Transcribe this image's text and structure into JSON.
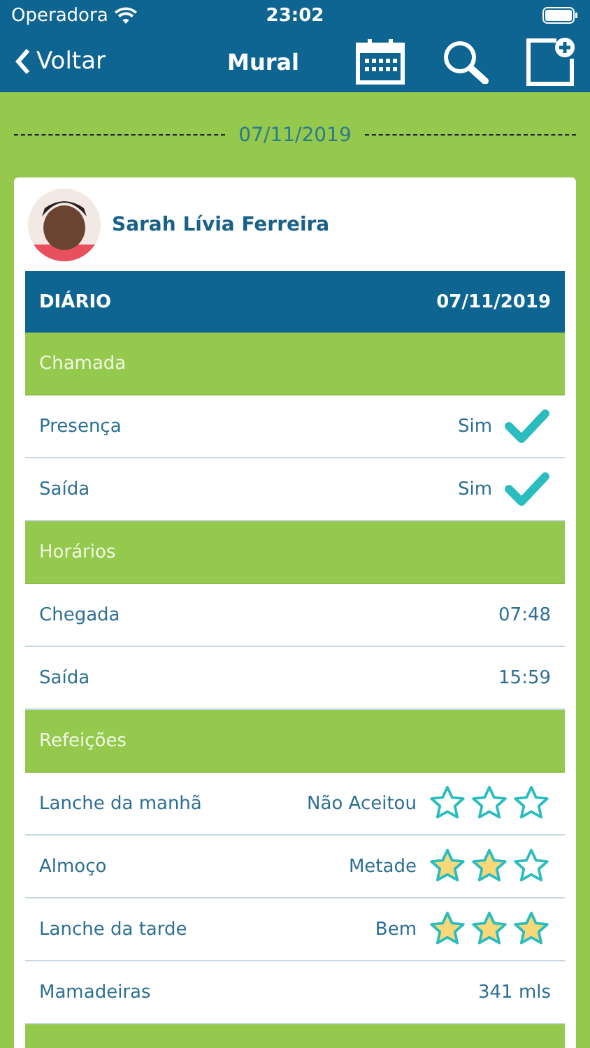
{
  "status_bar": {
    "carrier": "Operadora",
    "time": "23:02"
  },
  "nav": {
    "back": "Voltar",
    "title": "Mural"
  },
  "date_divider": "07/11/2019",
  "card": {
    "name": "Sarah Lívia Ferreira",
    "header": {
      "title": "DIÁRIO",
      "date": "07/11/2019"
    },
    "rows": [
      {
        "kind": "section",
        "label": "Chamada"
      },
      {
        "kind": "check",
        "label": "Presença",
        "value": "Sim",
        "checked": true
      },
      {
        "kind": "check",
        "label": "Saída",
        "value": "Sim",
        "checked": true
      },
      {
        "kind": "section",
        "label": "Horários"
      },
      {
        "kind": "text",
        "label": "Chegada",
        "value": "07:48"
      },
      {
        "kind": "text",
        "label": "Saída",
        "value": "15:59"
      },
      {
        "kind": "section",
        "label": "Refeições"
      },
      {
        "kind": "stars",
        "label": "Lanche da manhã",
        "value": "Não Aceitou",
        "stars": 0
      },
      {
        "kind": "stars",
        "label": "Almoço",
        "value": "Metade",
        "stars": 2
      },
      {
        "kind": "stars",
        "label": "Lanche da tarde",
        "value": "Bem",
        "stars": 3
      },
      {
        "kind": "text",
        "label": "Mamadeiras",
        "value": "341 mls"
      },
      {
        "kind": "section"
      }
    ]
  }
}
